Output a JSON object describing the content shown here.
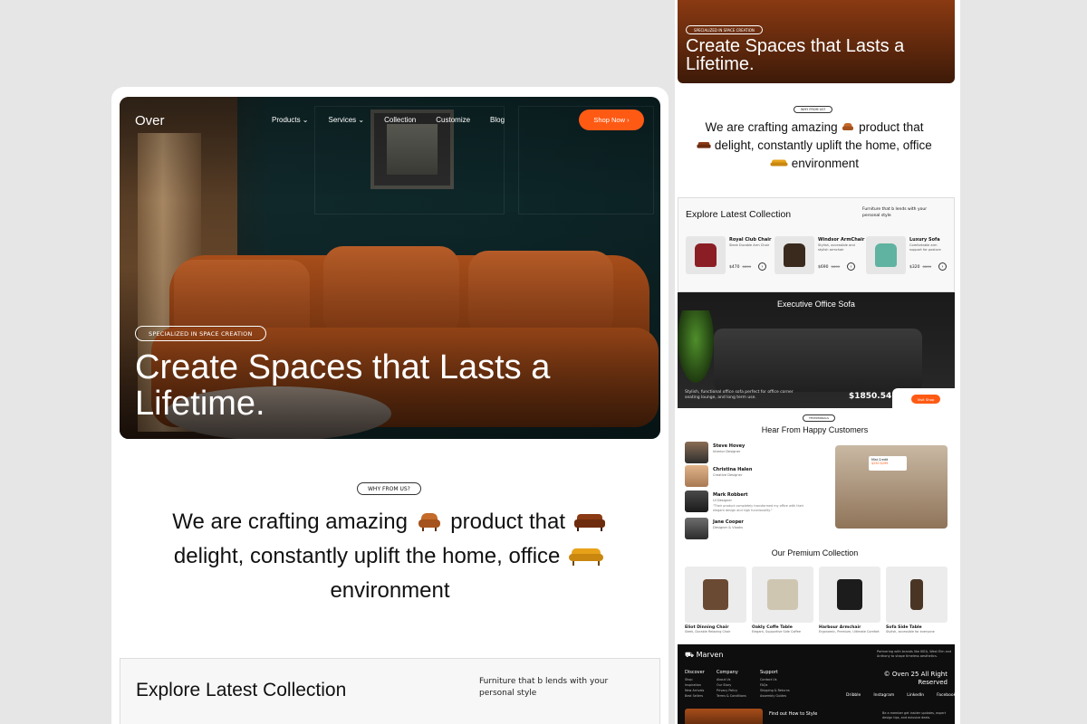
{
  "main": {
    "logo": "Over",
    "nav": [
      "Products ⌄",
      "Services ⌄",
      "Collection",
      "Customize",
      "Blog"
    ],
    "shop_button": "Shop Now ›",
    "hero_pill": "SPECIALIZED IN SPACE CREATION",
    "headline": "Create Spaces that Lasts a Lifetime.",
    "why_pill": "WHY FROM US?",
    "why_text": {
      "a": "We are crafting amazing",
      "b": "product that",
      "c": "delight, constantly uplift the home, office",
      "d": "environment"
    },
    "explore": {
      "title": "Explore Latest Collection",
      "subtitle": "Furniture that b lends with your personal style"
    }
  },
  "side": {
    "hero_pill": "SPECIALIZED IN SPACE CREATION",
    "headline": "Create Spaces that Lasts a Lifetime.",
    "why_pill": "WHY FROM US?",
    "why_text": {
      "a": "We are crafting amazing",
      "b": "product that",
      "c": "delight, constantly uplift the home, office",
      "d": "environment"
    },
    "explore": {
      "title": "Explore Latest Collection",
      "subtitle": "Furniture that b lends with your personal style",
      "products": [
        {
          "name": "Royal Club Chair",
          "desc": "Sleek Durable Arm Chair",
          "price": "$470",
          "old": "$860",
          "color": "#8b1e24"
        },
        {
          "name": "Windsor ArmChair",
          "desc": "Stylish, accessible and stylish armchair",
          "price": "$690",
          "old": "$860",
          "color": "#3a2a1e"
        },
        {
          "name": "Luxury Sofa",
          "desc": "Comfortable arm support for posture",
          "price": "$320",
          "old": "$860",
          "color": "#5fb3a0"
        }
      ]
    },
    "executive": {
      "title": "Executive Office Sofa",
      "desc": "Stylish, functional office sofa perfect for office corner seating lounge, and long term use.",
      "price": "$1850.54",
      "button": "Visit Shop"
    },
    "testimonials": {
      "pill": "TESTIMONIALS",
      "title": "Hear From Happy Customers",
      "people": [
        {
          "name": "Steve Hovey",
          "role": "Interior Designer",
          "quote": ""
        },
        {
          "name": "Christina Halen",
          "role": "Creative Designer",
          "quote": ""
        },
        {
          "name": "Mark Robbert",
          "role": "UI Designer",
          "quote": "\"Their product completely transformed my office with their elegant design and high functionality.\""
        },
        {
          "name": "Jane Cooper",
          "role": "Designer & Vlooks",
          "quote": ""
        }
      ],
      "room_tag": "Mist Credit",
      "room_price": "$250 $299"
    },
    "premium": {
      "title": "Our Premium Collection",
      "items": [
        {
          "name": "Eliot Dinning Chair",
          "desc": "Sleek, Durable Relaxing Chair",
          "color": "#6b4a33"
        },
        {
          "name": "Oakly Coffe Table",
          "desc": "Elegant, Supportive Side Coffee",
          "color": "#cfc6b2"
        },
        {
          "name": "Harbour Armchair",
          "desc": "Ergonomic, Premium, Ultimate Comfort",
          "color": "#1c1c1c"
        },
        {
          "name": "Sofa Side Table",
          "desc": "Stylish, accessible for everyone",
          "color": "#4a3524"
        }
      ]
    },
    "footer": {
      "brand": "⛟ Marven",
      "brand_desc": "Partnering with brands like IKEA, West Elm and Anthony to shape timeless aesthetics.",
      "cols": [
        {
          "h": "Discover",
          "items": [
            "Shop",
            "Inspiration",
            "New Arrivals",
            "Best Sellers"
          ]
        },
        {
          "h": "Company",
          "items": [
            "About Us",
            "Our Story",
            "Privacy Policy",
            "Terms & Conditions"
          ]
        },
        {
          "h": "Support",
          "items": [
            "Contact Us",
            "FAQs",
            "Shipping & Returns",
            "Assembly Guides"
          ]
        }
      ],
      "copyright": "© Oven 25 All Right Reserved",
      "social": [
        "Dribble",
        "Instagram",
        "LinkedIn",
        "Facebook"
      ],
      "find": "Find out How to Style",
      "news": "Be a member get insider updates, expert design tips, and exlusive deals."
    }
  },
  "colors": {
    "accent": "#ff5a14",
    "dark": "#0e0e0e",
    "bg": "#e6e6e6"
  }
}
